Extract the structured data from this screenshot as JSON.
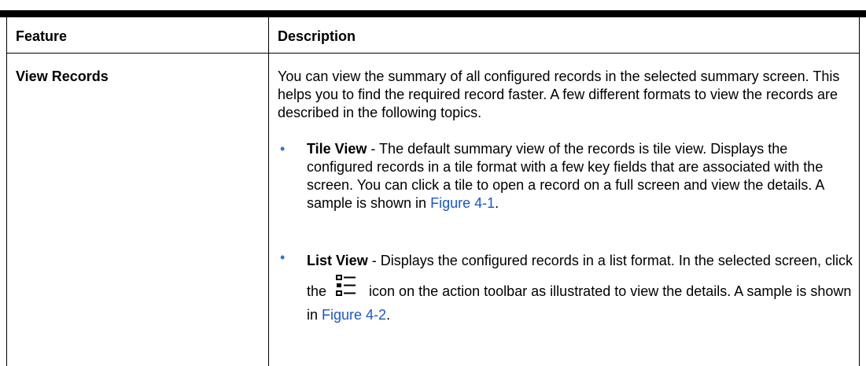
{
  "table": {
    "header": {
      "col1": "Feature",
      "col2": "Description"
    },
    "row": {
      "feature": "View Records",
      "intro": "You can view the summary of all configured records in the selected summary screen. This helps you to find the required record faster. A few different formats to view the records are described in the following topics.",
      "bullets": [
        {
          "term": "Tile View",
          "text_before": " - The default summary view of the records is tile view. Displays the configured records in a tile format with a few key fields that are associated with the screen. You can click a tile to open a record on a full screen and view the details. A sample is shown in ",
          "link": "Figure 4-1",
          "text_after": "."
        },
        {
          "term": "List View",
          "text_before": " - Displays the configured records in a list format. In the selected screen, click the ",
          "icon": "list-view-icon",
          "text_middle": " icon on the action toolbar as illustrated to view the details. A sample is shown in ",
          "link": "Figure 4-2",
          "text_after": "."
        }
      ]
    }
  }
}
